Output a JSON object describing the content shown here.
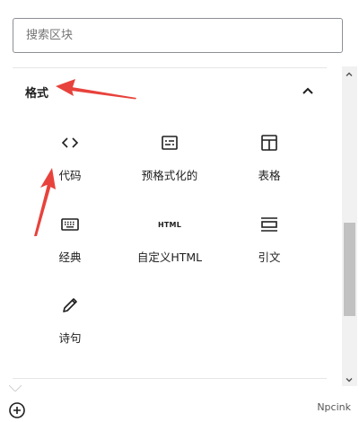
{
  "search": {
    "placeholder": "搜索区块"
  },
  "section": {
    "title": "格式"
  },
  "blocks": [
    {
      "label": "代码",
      "icon": "code-icon"
    },
    {
      "label": "预格式化的",
      "icon": "preformatted-icon"
    },
    {
      "label": "表格",
      "icon": "table-icon"
    },
    {
      "label": "经典",
      "icon": "keyboard-icon"
    },
    {
      "label": "自定义HTML",
      "icon": "html-icon",
      "icon_text": "HTML"
    },
    {
      "label": "引文",
      "icon": "pullquote-icon"
    },
    {
      "label": "诗句",
      "icon": "pencil-icon"
    }
  ],
  "footer": {
    "brand": "Npcink"
  },
  "colors": {
    "annotation_arrow": "#e8423c",
    "text": "#1e1e1e",
    "border": "#8c8f94"
  }
}
